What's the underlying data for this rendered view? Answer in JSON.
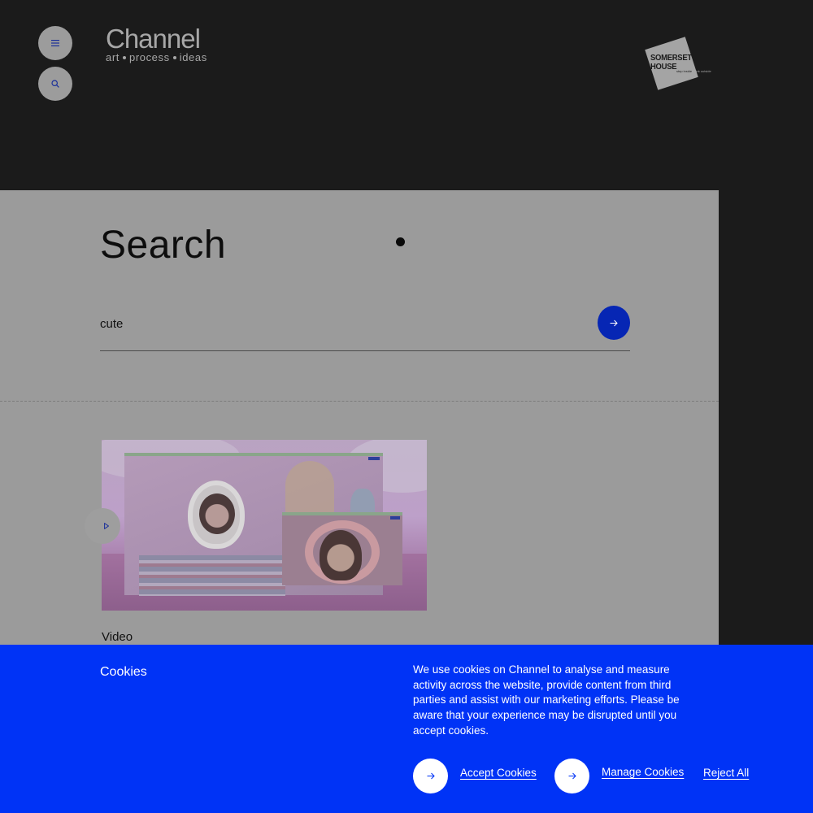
{
  "header": {
    "menu_button_icon": "hamburger-menu-icon",
    "search_button_icon": "search-icon",
    "logo": {
      "title": "Channel",
      "tagline": [
        "art",
        "process",
        "ideas"
      ]
    },
    "partner_logo": {
      "line1": "SOMERSET",
      "line2": "HOUSE",
      "sub_left": "step inside",
      "sub_right": "think outside"
    }
  },
  "search": {
    "title": "Search",
    "query": "cute",
    "submit_icon": "arrow-right-icon"
  },
  "results": [
    {
      "type": "Video",
      "play_icon": "play-icon"
    }
  ],
  "cookie_banner": {
    "heading": "Cookies",
    "body": "We use cookies on Channel to analyse and measure activity across the website, provide content from third parties and assist with our marketing efforts. Please be aware that your experience may be disrupted until you accept cookies.",
    "accept_label": "Accept Cookies",
    "manage_label": "Manage Cookies",
    "reject_label": "Reject All"
  },
  "colors": {
    "page_bg": "#1b1b1b",
    "panel_bg": "#9b9b9b",
    "accent_blue": "#0033f6",
    "submit_blue": "#0626b4"
  }
}
